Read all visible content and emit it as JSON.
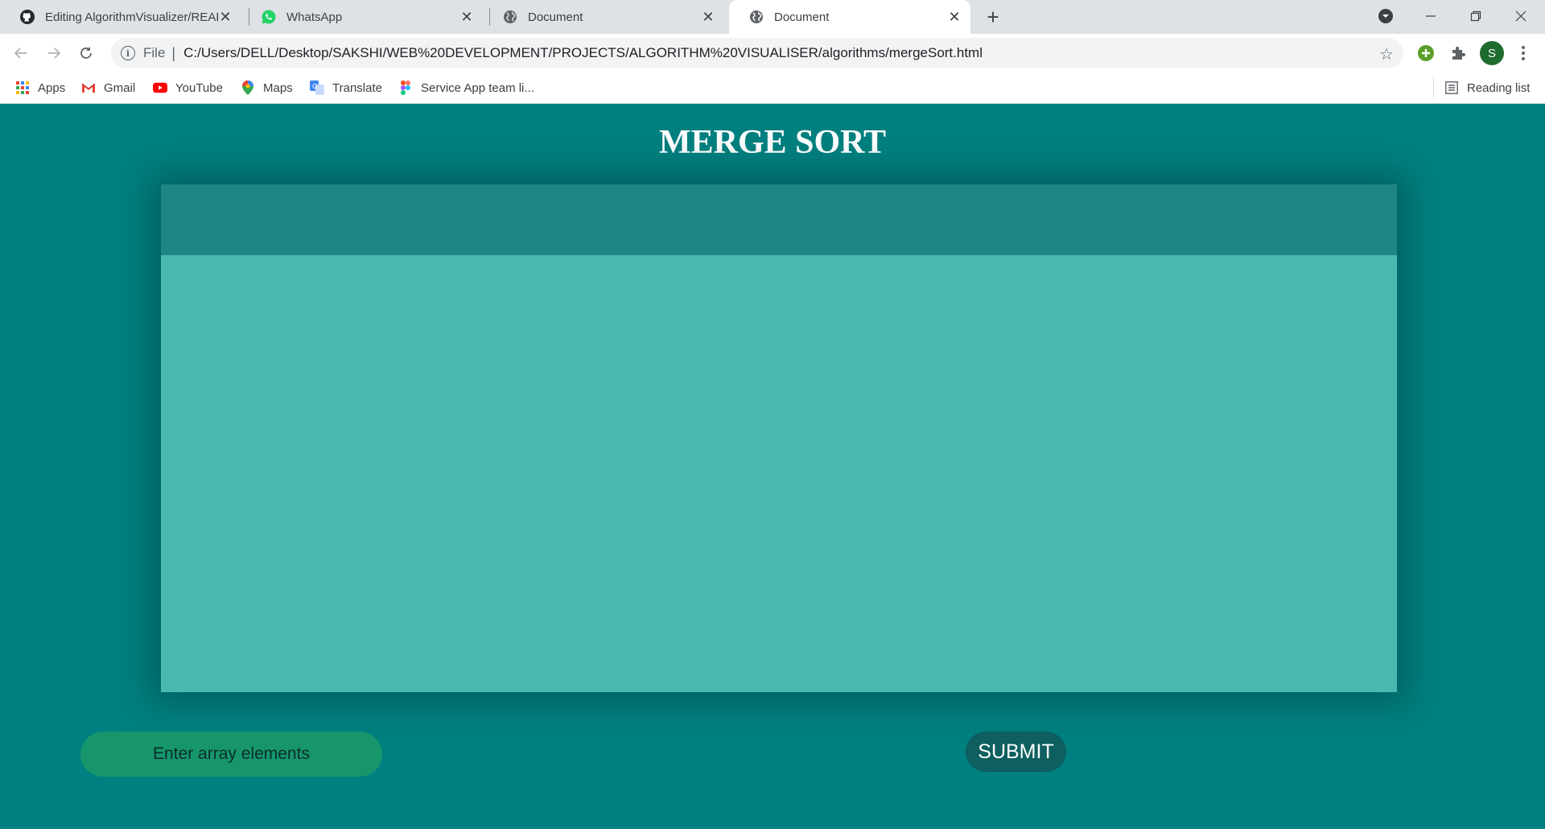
{
  "browser": {
    "tabs": [
      {
        "title": "Editing AlgorithmVisualizer/README.md",
        "icon": "github-icon",
        "active": false
      },
      {
        "title": "WhatsApp",
        "icon": "whatsapp-icon",
        "active": false
      },
      {
        "title": "Document",
        "icon": "globe-icon",
        "active": false
      },
      {
        "title": "Document",
        "icon": "globe-icon",
        "active": true
      }
    ],
    "address": {
      "scheme_label": "File",
      "url": "C:/Users/DELL/Desktop/SAKSHI/WEB%20DEVELOPMENT/PROJECTS/ALGORITHM%20VISUALISER/algorithms/mergeSort.html"
    },
    "profile_initial": "S",
    "bookmarks": [
      {
        "label": "Apps",
        "icon": "apps-grid-icon"
      },
      {
        "label": "Gmail",
        "icon": "gmail-icon"
      },
      {
        "label": "YouTube",
        "icon": "youtube-icon"
      },
      {
        "label": "Maps",
        "icon": "maps-icon"
      },
      {
        "label": "Translate",
        "icon": "translate-icon"
      },
      {
        "label": "Service App team li...",
        "icon": "figma-icon"
      }
    ],
    "reading_list_label": "Reading list"
  },
  "page": {
    "title": "MERGE SORT",
    "input_placeholder": "Enter array elements",
    "submit_label": "SUBMIT"
  },
  "colors": {
    "page_background": "#008080",
    "panel": "#48b8b0",
    "panel_header": "#1f8585",
    "input_background": "#17966c",
    "submit_background": "#0e5f60"
  }
}
